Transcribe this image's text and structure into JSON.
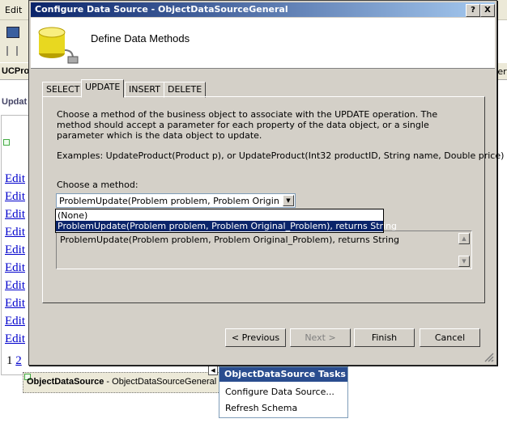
{
  "background": {
    "menu_edit": "Edit",
    "tab_left": "UCPro",
    "tab_right": "ter",
    "update_label": "Updat",
    "edit_links": [
      "Edit",
      "Edit",
      "Edit",
      "Edit",
      "Edit",
      "Edit",
      "Edit",
      "Edit",
      "Edit",
      "Edit"
    ],
    "pager": {
      "page1": "1",
      "page2": "2"
    },
    "ods_control": {
      "name": "ObjectDataSource",
      "separator": " - ",
      "id": "ObjectDataSourceGeneral"
    },
    "smart_tag_icon": "arrow-left-icon"
  },
  "tasks_panel": {
    "title": "ObjectDataSource Tasks",
    "items": [
      "Configure Data Source...",
      "Refresh Schema"
    ]
  },
  "dialog": {
    "title": "Configure Data Source - ObjectDataSourceGeneral",
    "help_btn": "?",
    "close_btn": "X",
    "header_title": "Define Data Methods",
    "header_icon": "database-icon",
    "tabs": [
      "SELECT",
      "UPDATE",
      "INSERT",
      "DELETE"
    ],
    "active_tab": "UPDATE",
    "description": "Choose a method of the business object to associate with the UPDATE operation. The method should accept a parameter for each property of the data object, or a single parameter which is the data object to update.",
    "examples": "Examples: UpdateProduct(Product p), or UpdateProduct(Int32 productID, String name, Double price)",
    "choose_label": "Choose a method:",
    "select_value": "ProblemUpdate(Problem problem, Problem Original_Problem",
    "dropdown_options": [
      "(None)",
      "ProblemUpdate(Problem problem, Problem Original_Problem), returns String"
    ],
    "selected_option_index": 1,
    "signature": "ProblemUpdate(Problem problem, Problem Original_Problem), returns String",
    "buttons": {
      "previous": "< Previous",
      "next": "Next >",
      "finish": "Finish",
      "cancel": "Cancel"
    }
  }
}
